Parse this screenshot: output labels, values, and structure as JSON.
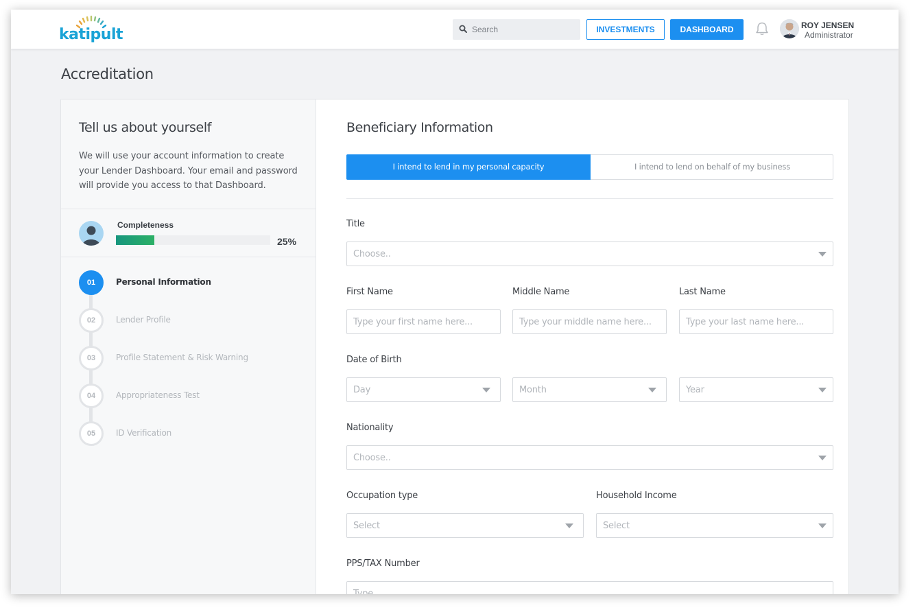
{
  "header": {
    "logo_text": "katipult",
    "search_placeholder": "Search",
    "investments_label": "INVESTMENTS",
    "dashboard_label": "DASHBOARD",
    "user_name": "ROY JENSEN",
    "user_role": "Administrator",
    "accent_color": "#1c8ff0"
  },
  "page": {
    "title": "Accreditation"
  },
  "sidebar": {
    "heading": "Tell us about yourself",
    "description": "We will use your account information to create your Lender Dashboard. Your email and password will provide you access to that Dashboard.",
    "completeness_label": "Completeness",
    "completeness_value": 0.25,
    "completeness_text": "25%",
    "steps": [
      {
        "number": "01",
        "label": "Personal Information",
        "active": true
      },
      {
        "number": "02",
        "label": "Lender Profile",
        "active": false
      },
      {
        "number": "03",
        "label": "Profile Statement & Risk Warning",
        "active": false
      },
      {
        "number": "04",
        "label": "Appropriateness Test",
        "active": false
      },
      {
        "number": "05",
        "label": "ID Verification",
        "active": false
      }
    ]
  },
  "form": {
    "heading": "Beneficiary Information",
    "capacity_options": [
      {
        "label": "I intend to lend in my personal capacity",
        "selected": true
      },
      {
        "label": "I intend to lend on behalf of my business",
        "selected": false
      }
    ],
    "title": {
      "label": "Title",
      "placeholder": "Choose.."
    },
    "first_name": {
      "label": "First Name",
      "placeholder": "Type your first name here..."
    },
    "middle_name": {
      "label": "Middle Name",
      "placeholder": "Type your middle name here..."
    },
    "last_name": {
      "label": "Last Name",
      "placeholder": "Type your last name here..."
    },
    "dob": {
      "label": "Date of Birth",
      "day": "Day",
      "month": "Month",
      "year": "Year"
    },
    "nationality": {
      "label": "Nationality",
      "placeholder": "Choose.."
    },
    "occupation": {
      "label": "Occupation type",
      "placeholder": "Select"
    },
    "income": {
      "label": "Household Income",
      "placeholder": "Select"
    },
    "tax": {
      "label": "PPS/TAX Number",
      "placeholder": "Type"
    }
  }
}
